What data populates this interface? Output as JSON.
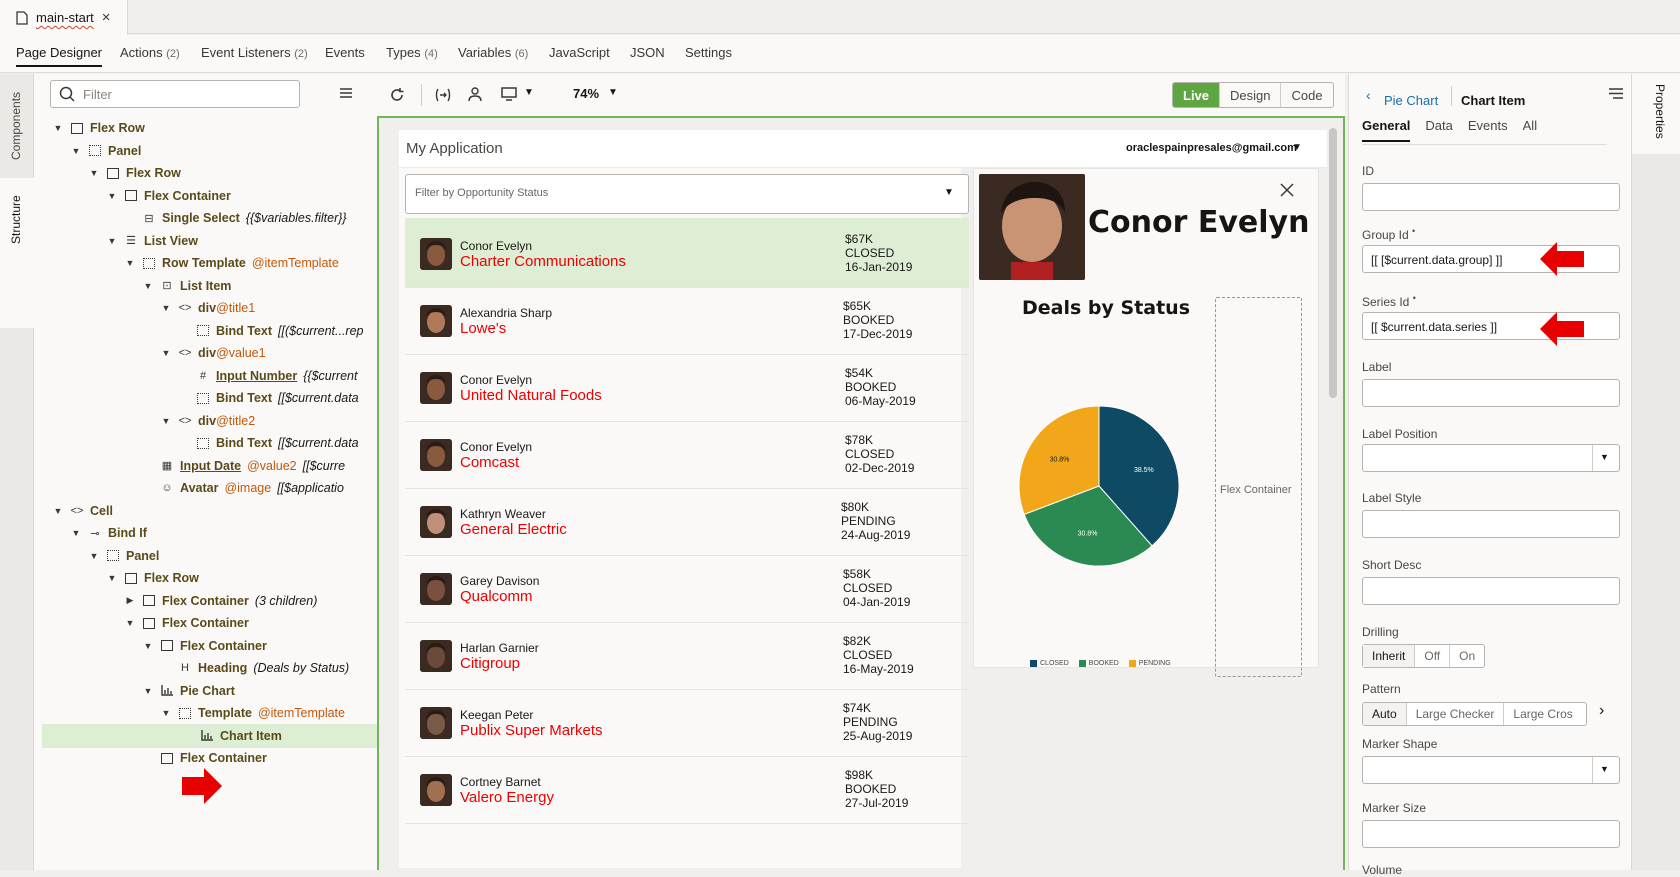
{
  "tab": {
    "title": "main-start",
    "close": "×"
  },
  "nav": {
    "items": [
      {
        "label": "Page Designer",
        "count": ""
      },
      {
        "label": "Actions",
        "count": "(2)"
      },
      {
        "label": "Event Listeners",
        "count": "(2)"
      },
      {
        "label": "Events",
        "count": ""
      },
      {
        "label": "Types",
        "count": "(4)"
      },
      {
        "label": "Variables",
        "count": "(6)"
      },
      {
        "label": "JavaScript",
        "count": ""
      },
      {
        "label": "JSON",
        "count": ""
      },
      {
        "label": "Settings",
        "count": ""
      }
    ]
  },
  "side_tabs": {
    "components": "Components",
    "structure": "Structure"
  },
  "structure": {
    "filter_placeholder": "Filter",
    "tree": [
      {
        "name": "Flex Row",
        "id": "",
        "ex": ""
      },
      {
        "name": "Panel",
        "id": "",
        "ex": ""
      },
      {
        "name": "Flex Row",
        "id": "",
        "ex": ""
      },
      {
        "name": "Flex Container",
        "id": "",
        "ex": ""
      },
      {
        "name": "Single Select",
        "id": "",
        "ex": "{{$variables.filter}}"
      },
      {
        "name": "List View",
        "id": "",
        "ex": ""
      },
      {
        "name": "Row Template",
        "id": "@itemTemplate",
        "ex": ""
      },
      {
        "name": "List Item",
        "id": "",
        "ex": ""
      },
      {
        "name": "div",
        "id": "@title1",
        "ex": ""
      },
      {
        "name": "Bind Text",
        "id": "",
        "ex": "[[($current...rep"
      },
      {
        "name": "div",
        "id": "@value1",
        "ex": ""
      },
      {
        "name": "Input Number",
        "id": "",
        "ex": "{{$current"
      },
      {
        "name": "Bind Text",
        "id": "",
        "ex": "[[$current.data"
      },
      {
        "name": "div",
        "id": "@title2",
        "ex": ""
      },
      {
        "name": "Bind Text",
        "id": "",
        "ex": "[[$current.data"
      },
      {
        "name": "Input Date",
        "id": "@value2",
        "ex": "[[$curre"
      },
      {
        "name": "Avatar",
        "id": "@image",
        "ex": "[[$applicatio"
      },
      {
        "name": "Cell",
        "id": "",
        "ex": ""
      },
      {
        "name": "Bind If",
        "id": "",
        "ex": ""
      },
      {
        "name": "Panel",
        "id": "",
        "ex": ""
      },
      {
        "name": "Flex Row",
        "id": "",
        "ex": ""
      },
      {
        "name": "Flex Container",
        "id": "",
        "ex": "(3 children)"
      },
      {
        "name": "Flex Container",
        "id": "",
        "ex": ""
      },
      {
        "name": "Flex Container",
        "id": "",
        "ex": ""
      },
      {
        "name": "Heading",
        "id": "",
        "ex": "(Deals by Status)"
      },
      {
        "name": "Pie Chart",
        "id": "",
        "ex": ""
      },
      {
        "name": "Template",
        "id": "@itemTemplate",
        "ex": ""
      },
      {
        "name": "Chart Item",
        "id": "",
        "ex": ""
      },
      {
        "name": "Flex Container",
        "id": "",
        "ex": ""
      }
    ]
  },
  "toolbar": {
    "zoom": "74%",
    "modes": [
      "Live",
      "Design",
      "Code"
    ]
  },
  "app": {
    "title": "My Application",
    "user": "oraclespainpresales@gmail.com",
    "filter_placeholder": "Filter by Opportunity Status",
    "rows": [
      {
        "name": "Conor Evelyn",
        "company": "Charter Communications",
        "amount": "$67K",
        "status": "CLOSED",
        "date": "16-Jan-2019"
      },
      {
        "name": "Alexandria Sharp",
        "company": "Lowe's",
        "amount": "$65K",
        "status": "BOOKED",
        "date": "17-Dec-2019"
      },
      {
        "name": "Conor Evelyn",
        "company": "United Natural Foods",
        "amount": "$54K",
        "status": "BOOKED",
        "date": "06-May-2019"
      },
      {
        "name": "Conor Evelyn",
        "company": "Comcast",
        "amount": "$78K",
        "status": "CLOSED",
        "date": "02-Dec-2019"
      },
      {
        "name": "Kathryn Weaver",
        "company": "General Electric",
        "amount": "$80K",
        "status": "PENDING",
        "date": "24-Aug-2019"
      },
      {
        "name": "Garey Davison",
        "company": "Qualcomm",
        "amount": "$58K",
        "status": "CLOSED",
        "date": "04-Jan-2019"
      },
      {
        "name": "Harlan Garnier",
        "company": "Citigroup",
        "amount": "$82K",
        "status": "CLOSED",
        "date": "16-May-2019"
      },
      {
        "name": "Keegan Peter",
        "company": "Publix Super Markets",
        "amount": "$74K",
        "status": "PENDING",
        "date": "25-Aug-2019"
      },
      {
        "name": "Cortney Barnet",
        "company": "Valero Energy",
        "amount": "$98K",
        "status": "BOOKED",
        "date": "27-Jul-2019"
      }
    ],
    "detail": {
      "name": "Conor Evelyn",
      "chart_title": "Deals by Status",
      "flex_container": "Flex Container"
    }
  },
  "chart_data": {
    "type": "pie",
    "title": "Deals by Status",
    "categories": [
      "CLOSED",
      "BOOKED",
      "PENDING"
    ],
    "values": [
      38.5,
      30.8,
      30.8
    ],
    "labels": [
      "38.5%",
      "30.8%",
      "30.8%"
    ],
    "colors": [
      "#0e4a63",
      "#2a8a52",
      "#f2a71b"
    ],
    "legend": "bottom"
  },
  "props": {
    "breadcrumb_parent": "Pie Chart",
    "breadcrumb_current": "Chart Item",
    "tabs": [
      "General",
      "Data",
      "Events",
      "All"
    ],
    "fields": {
      "id": {
        "label": "ID",
        "value": ""
      },
      "group_id": {
        "label": "Group Id",
        "value": "[[ [$current.data.group] ]]"
      },
      "series_id": {
        "label": "Series Id",
        "value": "[[ $current.data.series ]]"
      },
      "label": {
        "label": "Label",
        "value": ""
      },
      "label_position": {
        "label": "Label Position",
        "value": ""
      },
      "label_style": {
        "label": "Label Style",
        "value": ""
      },
      "short_desc": {
        "label": "Short Desc",
        "value": ""
      },
      "drilling": {
        "label": "Drilling",
        "options": [
          "Inherit",
          "Off",
          "On"
        ]
      },
      "pattern": {
        "label": "Pattern",
        "options": [
          "Auto",
          "Large Checker",
          "Large Cros"
        ]
      },
      "marker_shape": {
        "label": "Marker Shape",
        "value": ""
      },
      "marker_size": {
        "label": "Marker Size",
        "value": ""
      },
      "volume": {
        "label": "Volume"
      }
    },
    "side_label": "Properties"
  },
  "colors": {
    "accent_green": "#5fa642",
    "selection": "#ddeed5",
    "company_red": "#e00000",
    "arrow_red": "#e80000"
  }
}
